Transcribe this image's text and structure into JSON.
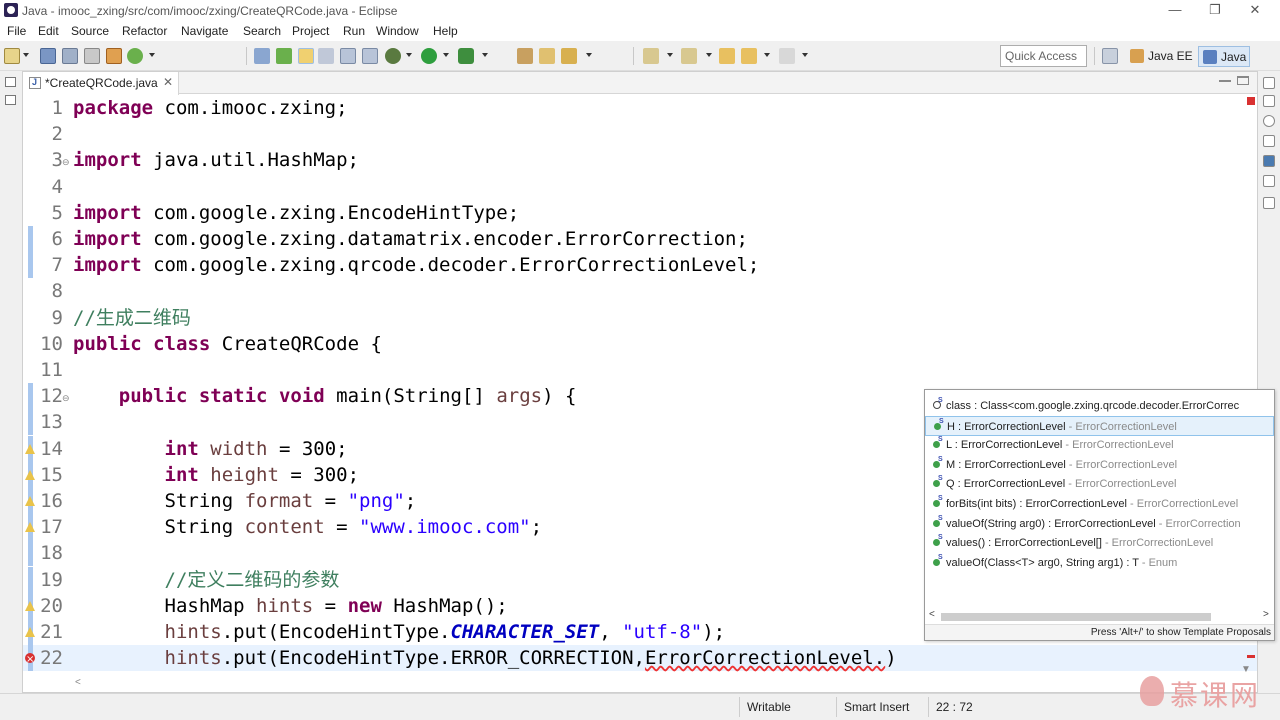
{
  "window": {
    "title": "Java - imooc_zxing/src/com/imooc/zxing/CreateQRCode.java - Eclipse",
    "minimize": "—",
    "maximize": "❐",
    "close": "✕"
  },
  "menu": [
    "File",
    "Edit",
    "Source",
    "Refactor",
    "Navigate",
    "Search",
    "Project",
    "Run",
    "Window",
    "Help"
  ],
  "toolbar": {
    "quick_access_placeholder": "Quick Access",
    "perspectives": [
      {
        "label": "Java EE"
      },
      {
        "label": "Java",
        "active": true
      }
    ]
  },
  "editor": {
    "tab_label": "*CreateQRCode.java",
    "tab_close": "✕",
    "lines": [
      {
        "n": "1",
        "parts": [
          {
            "t": "package",
            "c": "kw"
          },
          {
            "t": " com.imooc.zxing;"
          }
        ]
      },
      {
        "n": "2",
        "parts": []
      },
      {
        "n": "3",
        "fold": true,
        "parts": [
          {
            "t": "import",
            "c": "kw"
          },
          {
            "t": " java.util.HashMap;"
          }
        ]
      },
      {
        "n": "4",
        "parts": []
      },
      {
        "n": "5",
        "parts": [
          {
            "t": "import",
            "c": "kw"
          },
          {
            "t": " com.google.zxing.EncodeHintType;"
          }
        ]
      },
      {
        "n": "6",
        "mark": true,
        "parts": [
          {
            "t": "import",
            "c": "kw"
          },
          {
            "t": " com.google.zxing.datamatrix.encoder.ErrorCorrection;"
          }
        ]
      },
      {
        "n": "7",
        "mark": true,
        "parts": [
          {
            "t": "import",
            "c": "kw"
          },
          {
            "t": " com.google.zxing.qrcode.decoder.ErrorCorrectionLevel;"
          }
        ]
      },
      {
        "n": "8",
        "parts": []
      },
      {
        "n": "9",
        "parts": [
          {
            "t": "//生成二维码",
            "c": "cm"
          }
        ]
      },
      {
        "n": "10",
        "parts": [
          {
            "t": "public",
            "c": "kw"
          },
          {
            "t": " "
          },
          {
            "t": "class",
            "c": "kw"
          },
          {
            "t": " CreateQRCode {"
          }
        ]
      },
      {
        "n": "11",
        "parts": []
      },
      {
        "n": "12",
        "mark": true,
        "fold": true,
        "parts": [
          {
            "t": "    "
          },
          {
            "t": "public",
            "c": "kw"
          },
          {
            "t": " "
          },
          {
            "t": "static",
            "c": "kw"
          },
          {
            "t": " "
          },
          {
            "t": "void",
            "c": "kw"
          },
          {
            "t": " main(String[] "
          },
          {
            "t": "args",
            "c": "vr"
          },
          {
            "t": ") {"
          }
        ]
      },
      {
        "n": "13",
        "mark": true,
        "parts": []
      },
      {
        "n": "14",
        "mark": true,
        "icon": "w",
        "parts": [
          {
            "t": "        "
          },
          {
            "t": "int",
            "c": "kw"
          },
          {
            "t": " "
          },
          {
            "t": "width",
            "c": "vr"
          },
          {
            "t": " = 300;"
          }
        ]
      },
      {
        "n": "15",
        "mark": true,
        "icon": "w",
        "parts": [
          {
            "t": "        "
          },
          {
            "t": "int",
            "c": "kw"
          },
          {
            "t": " "
          },
          {
            "t": "height",
            "c": "vr"
          },
          {
            "t": " = 300;"
          }
        ]
      },
      {
        "n": "16",
        "mark": true,
        "icon": "w",
        "parts": [
          {
            "t": "        String "
          },
          {
            "t": "format",
            "c": "vr"
          },
          {
            "t": " = "
          },
          {
            "t": "\"png\"",
            "c": "st"
          },
          {
            "t": ";"
          }
        ]
      },
      {
        "n": "17",
        "mark": true,
        "icon": "w",
        "parts": [
          {
            "t": "        String "
          },
          {
            "t": "content",
            "c": "vr"
          },
          {
            "t": " = "
          },
          {
            "t": "\"www.imooc.com\"",
            "c": "st"
          },
          {
            "t": ";"
          }
        ]
      },
      {
        "n": "18",
        "mark": true,
        "parts": []
      },
      {
        "n": "19",
        "mark": true,
        "parts": [
          {
            "t": "        "
          },
          {
            "t": "//定义二维码的参数",
            "c": "cm"
          }
        ]
      },
      {
        "n": "20",
        "mark": true,
        "icon": "w",
        "parts": [
          {
            "t": "        HashMap "
          },
          {
            "t": "hints",
            "c": "vr"
          },
          {
            "t": " = "
          },
          {
            "t": "new",
            "c": "kw"
          },
          {
            "t": " HashMap();"
          }
        ]
      },
      {
        "n": "21",
        "mark": true,
        "icon": "w",
        "parts": [
          {
            "t": "        "
          },
          {
            "t": "hints",
            "c": "vr"
          },
          {
            "t": ".put(EncodeHintType."
          },
          {
            "t": "CHARACTER_SET",
            "c": "fd"
          },
          {
            "t": ", "
          },
          {
            "t": "\"utf-8\"",
            "c": "st"
          },
          {
            "t": ");"
          }
        ]
      },
      {
        "n": "22",
        "mark": true,
        "icon": "e",
        "current": true,
        "parts": [
          {
            "t": "        "
          },
          {
            "t": "hints",
            "c": "vr"
          },
          {
            "t": ".put(EncodeHintType.ERROR_CORRECTION,"
          },
          {
            "t": "ErrorCorrectionLevel.",
            "c": "squig"
          },
          {
            "t": ")"
          }
        ]
      }
    ]
  },
  "assist": {
    "items": [
      {
        "kind": "field",
        "main": "class : Class<com.google.zxing.qrcode.decoder.ErrorCorrec",
        "dim": ""
      },
      {
        "kind": "static",
        "main": "H : ErrorCorrectionLevel",
        "dim": " - ErrorCorrectionLevel",
        "selected": true
      },
      {
        "kind": "static",
        "main": "L : ErrorCorrectionLevel",
        "dim": " - ErrorCorrectionLevel"
      },
      {
        "kind": "static",
        "main": "M : ErrorCorrectionLevel",
        "dim": " - ErrorCorrectionLevel"
      },
      {
        "kind": "static",
        "main": "Q : ErrorCorrectionLevel",
        "dim": " - ErrorCorrectionLevel"
      },
      {
        "kind": "method",
        "main": "forBits(int bits) : ErrorCorrectionLevel",
        "dim": " - ErrorCorrectionLevel"
      },
      {
        "kind": "method",
        "main": "valueOf(String arg0) : ErrorCorrectionLevel",
        "dim": " - ErrorCorrection"
      },
      {
        "kind": "method",
        "main": "values() : ErrorCorrectionLevel[]",
        "dim": " - ErrorCorrectionLevel"
      },
      {
        "kind": "method",
        "main": "valueOf(Class<T> arg0, String arg1) : T",
        "dim": " - Enum"
      }
    ],
    "scroll_left": "<",
    "scroll_right": ">",
    "status": "Press 'Alt+/' to show Template Proposals"
  },
  "statusbar": {
    "writable": "Writable",
    "insert_mode": "Smart Insert",
    "position": "22 : 72"
  },
  "watermark": {
    "text": "慕课网"
  }
}
